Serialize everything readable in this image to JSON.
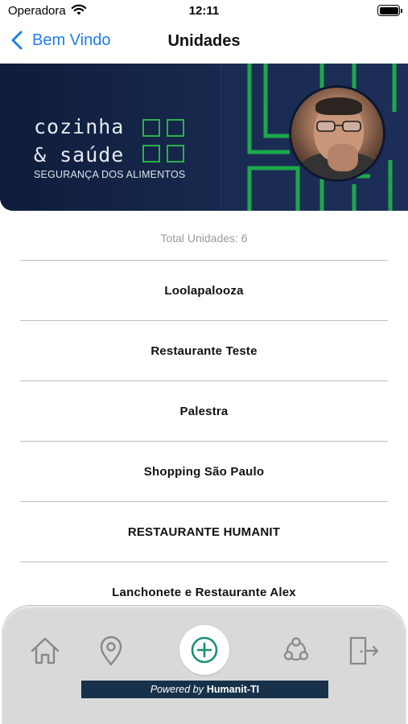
{
  "status_bar": {
    "carrier": "Operadora",
    "time": "12:11"
  },
  "nav": {
    "back_label": "Bem Vindo",
    "title": "Unidades"
  },
  "banner": {
    "brand_line1": "cozinha",
    "brand_line2": "& saúde",
    "brand_subtitle": "SEGURANÇA DOS ALIMENTOS",
    "accent_color": "#2bb24a"
  },
  "content": {
    "total_label": "Total Unidades: 6",
    "units": [
      "Loolapalooza",
      "Restaurante Teste",
      "Palestra",
      "Shopping São Paulo",
      "RESTAURANTE HUMANIT",
      "Lanchonete e Restaurante Alex"
    ]
  },
  "tab_bar": {
    "icons": [
      "home-icon",
      "map-pin-icon",
      "add-icon",
      "share-network-icon",
      "logout-icon"
    ],
    "powered_by_prefix": "Powered by",
    "powered_by_brand": "Humanit-TI",
    "accent_color": "#1a8f76"
  }
}
